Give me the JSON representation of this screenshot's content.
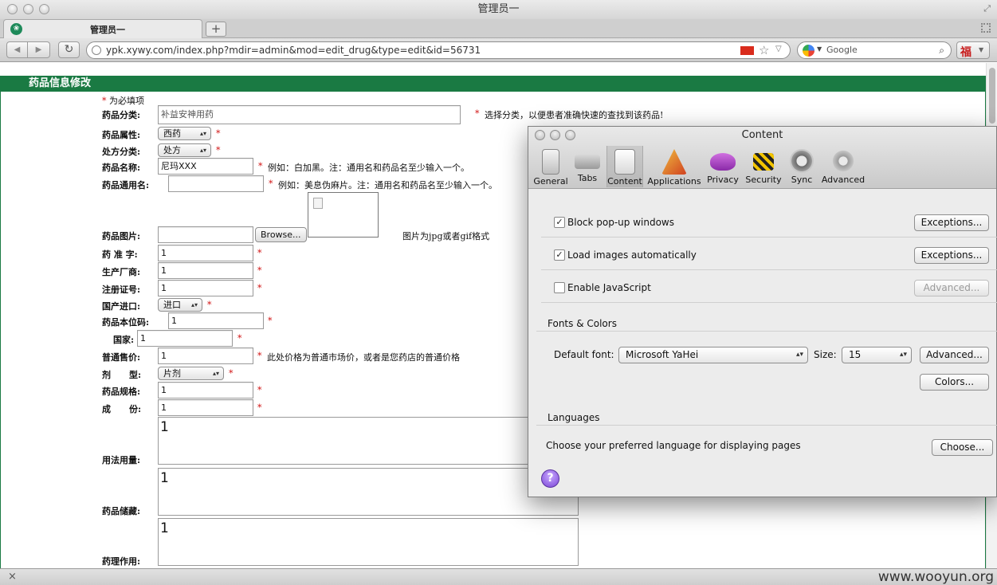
{
  "window": {
    "title": "管理员一"
  },
  "tab": {
    "label": "管理员一",
    "new_tab_symbol": "+"
  },
  "toolbar": {
    "back": "◀",
    "forward": "▶",
    "reload": "↻",
    "url": "ypk.xywy.com/index.php?mdir=admin&mod=edit_drug&type=edit&id=56731",
    "search_placeholder": "Google"
  },
  "page": {
    "header": "药品信息修改",
    "required_note": "为必填项",
    "required_mark": "*",
    "fields": {
      "category": {
        "label": "药品分类:",
        "value": "补益安神用药",
        "hint": "选择分类，以便患者准确快速的查找到该药品!"
      },
      "attribute": {
        "label": "药品属性:",
        "value": "西药"
      },
      "prescription": {
        "label": "处方分类:",
        "value": "处方"
      },
      "drug_name": {
        "label": "药品名称:",
        "value": "尼玛XXX",
        "hint": "例如：白加黑。注：通用名和药品名至少输入一个。"
      },
      "generic_name": {
        "label": "药品通用名:",
        "value": "",
        "hint": "例如：美息伪麻片。注：通用名和药品名至少输入一个。"
      },
      "image": {
        "label": "药品图片:",
        "button": "Browse...",
        "hint": "图片为jpg或者gif格式"
      },
      "approval": {
        "label": "药 准 字:",
        "value": "1"
      },
      "manufacturer": {
        "label": "生产厂商:",
        "value": "1"
      },
      "registration": {
        "label": "注册证号:",
        "value": "1"
      },
      "origin": {
        "label": "国产进口:",
        "value": "进口"
      },
      "standard_code": {
        "label": "药品本位码:",
        "value": "1"
      },
      "country": {
        "label": "国家:",
        "value": "1"
      },
      "price": {
        "label": "普通售价:",
        "value": "1",
        "hint": "此处价格为普通市场价，或者是您药店的普通价格"
      },
      "dosage_form": {
        "label": "剂      型:",
        "value": "片剂"
      },
      "spec": {
        "label": "药品规格:",
        "value": "1"
      },
      "ingredients": {
        "label": "成      份:",
        "value": "1"
      },
      "usage": {
        "label": "用法用量:",
        "value": "1"
      },
      "storage": {
        "label": "药品储藏:",
        "value": "1"
      },
      "pharmacology": {
        "label": "药理作用:",
        "value": "1"
      }
    }
  },
  "status": {
    "close": "×",
    "watermark": "www.wooyun.org"
  },
  "dialog": {
    "title": "Content",
    "tabs": [
      {
        "label": "General",
        "icon": "general-icon"
      },
      {
        "label": "Tabs",
        "icon": "tabs-icon"
      },
      {
        "label": "Content",
        "icon": "content-icon"
      },
      {
        "label": "Applications",
        "icon": "applications-icon"
      },
      {
        "label": "Privacy",
        "icon": "privacy-icon"
      },
      {
        "label": "Security",
        "icon": "security-icon"
      },
      {
        "label": "Sync",
        "icon": "sync-icon"
      },
      {
        "label": "Advanced",
        "icon": "advanced-icon"
      }
    ],
    "block_popups": {
      "label": "Block pop-up windows",
      "checked": "✓",
      "button": "Exceptions..."
    },
    "load_images": {
      "label": "Load images automatically",
      "checked": "✓",
      "button": "Exceptions..."
    },
    "enable_js": {
      "label": "Enable JavaScript",
      "button": "Advanced..."
    },
    "fonts_section": "Fonts & Colors",
    "default_font_label": "Default font:",
    "default_font_value": "Microsoft YaHei",
    "size_label": "Size:",
    "size_value": "15",
    "fonts_advanced": "Advanced...",
    "colors_button": "Colors...",
    "languages_section": "Languages",
    "languages_text": "Choose your preferred language for displaying pages",
    "choose_button": "Choose...",
    "help": "?"
  }
}
